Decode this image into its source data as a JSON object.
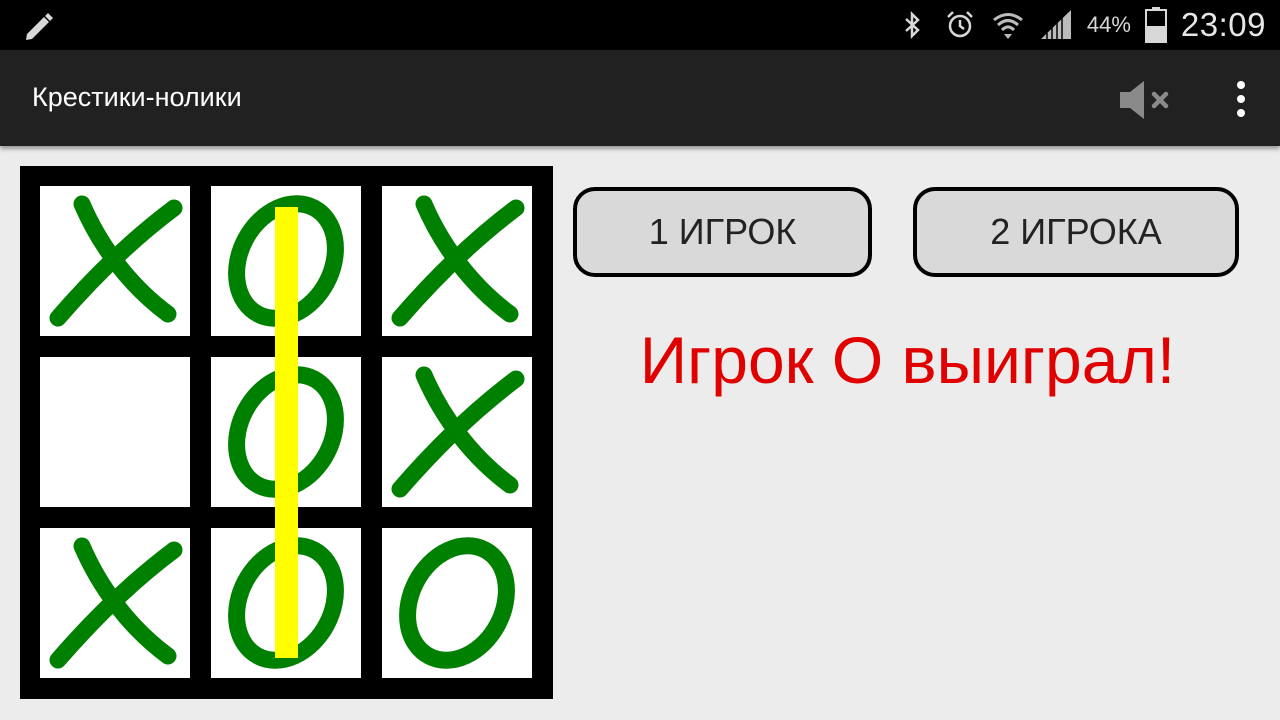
{
  "status_bar": {
    "left_icon": "pencil-icon",
    "icons": [
      "bluetooth-icon",
      "alarm-icon",
      "wifi-icon",
      "signal-icon"
    ],
    "battery_percent": "44%",
    "battery_icon": "battery-icon",
    "time": "23:09"
  },
  "app_bar": {
    "title": "Крестики-нолики",
    "actions": [
      "sound-off-icon",
      "more-vert-icon"
    ]
  },
  "board": {
    "cells": [
      [
        "X",
        "O",
        "X"
      ],
      [
        "",
        "O",
        "X"
      ],
      [
        "X",
        "O",
        "O"
      ]
    ],
    "winning_line": "column 2",
    "mark_color": "#008000",
    "line_color": "#ffff00"
  },
  "buttons": {
    "one_player": "1 ИГРОК",
    "two_players": "2 ИГРОКА"
  },
  "result_text": "Игрок О выиграл!",
  "colors": {
    "result": "#e00000",
    "app_bar": "#212121",
    "background": "#ececec"
  }
}
